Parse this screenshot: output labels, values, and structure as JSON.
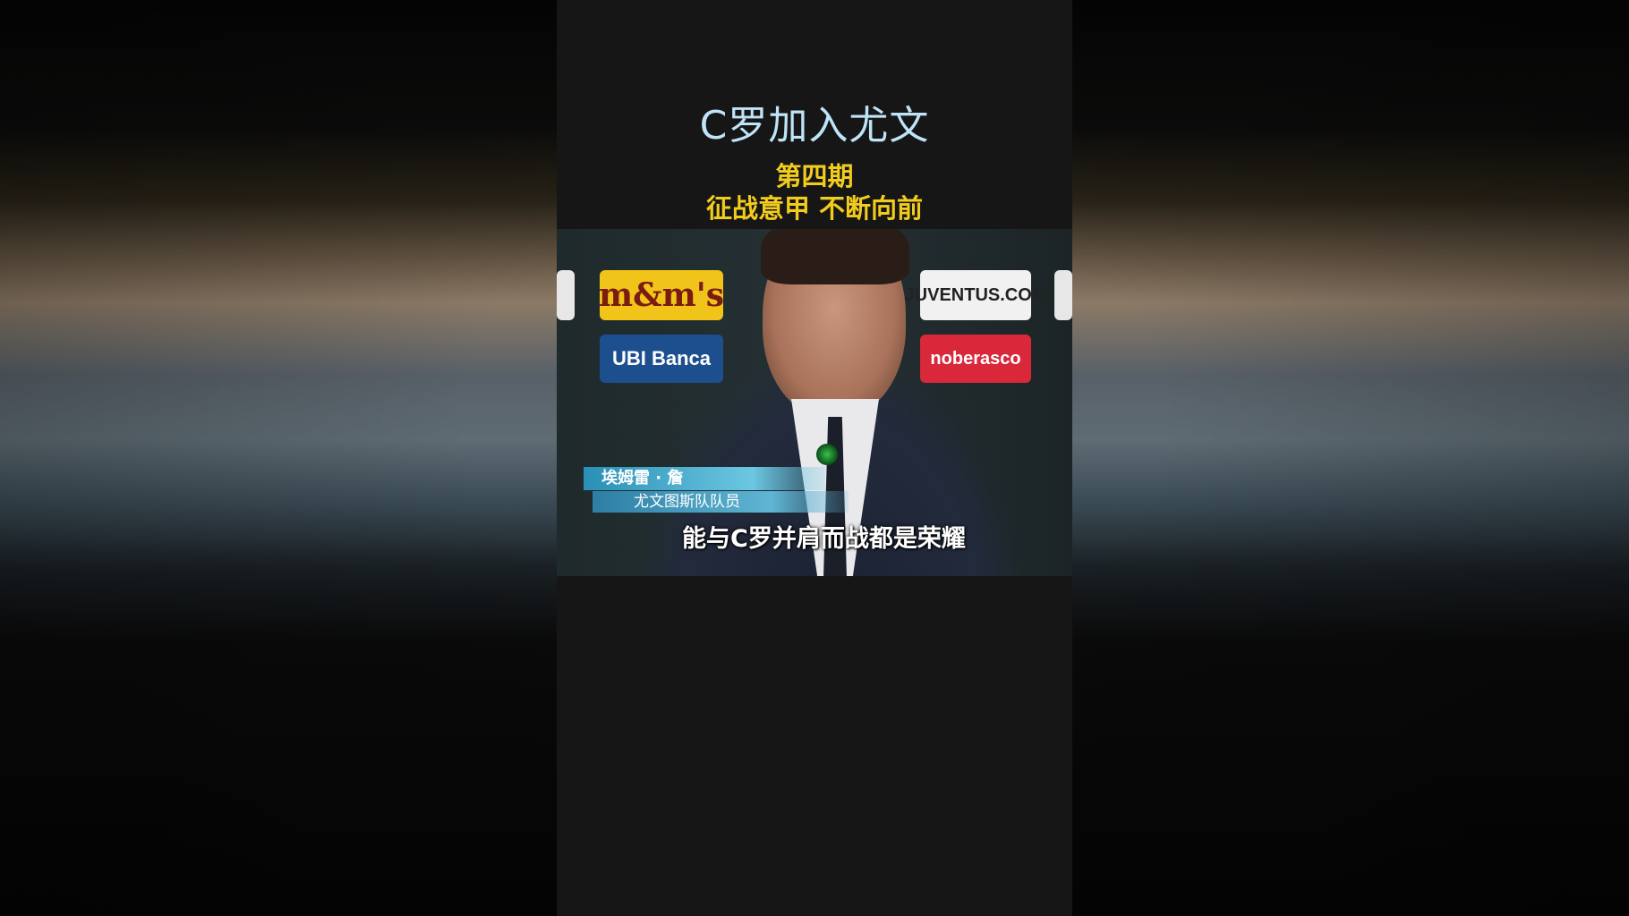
{
  "header": {
    "title": "C罗加入尤文",
    "episode": "第四期",
    "subtitle": "征战意甲 不断向前"
  },
  "video": {
    "sponsors": {
      "mm": "m&m's",
      "ubi": "UBI Banca",
      "juve": "JUVENTUS.COM",
      "nobe": "noberasco"
    },
    "name_tag": "埃姆雷 · 詹",
    "role_tag": "尤文图斯队队员",
    "caption": "能与C罗并肩而战都是荣耀"
  }
}
